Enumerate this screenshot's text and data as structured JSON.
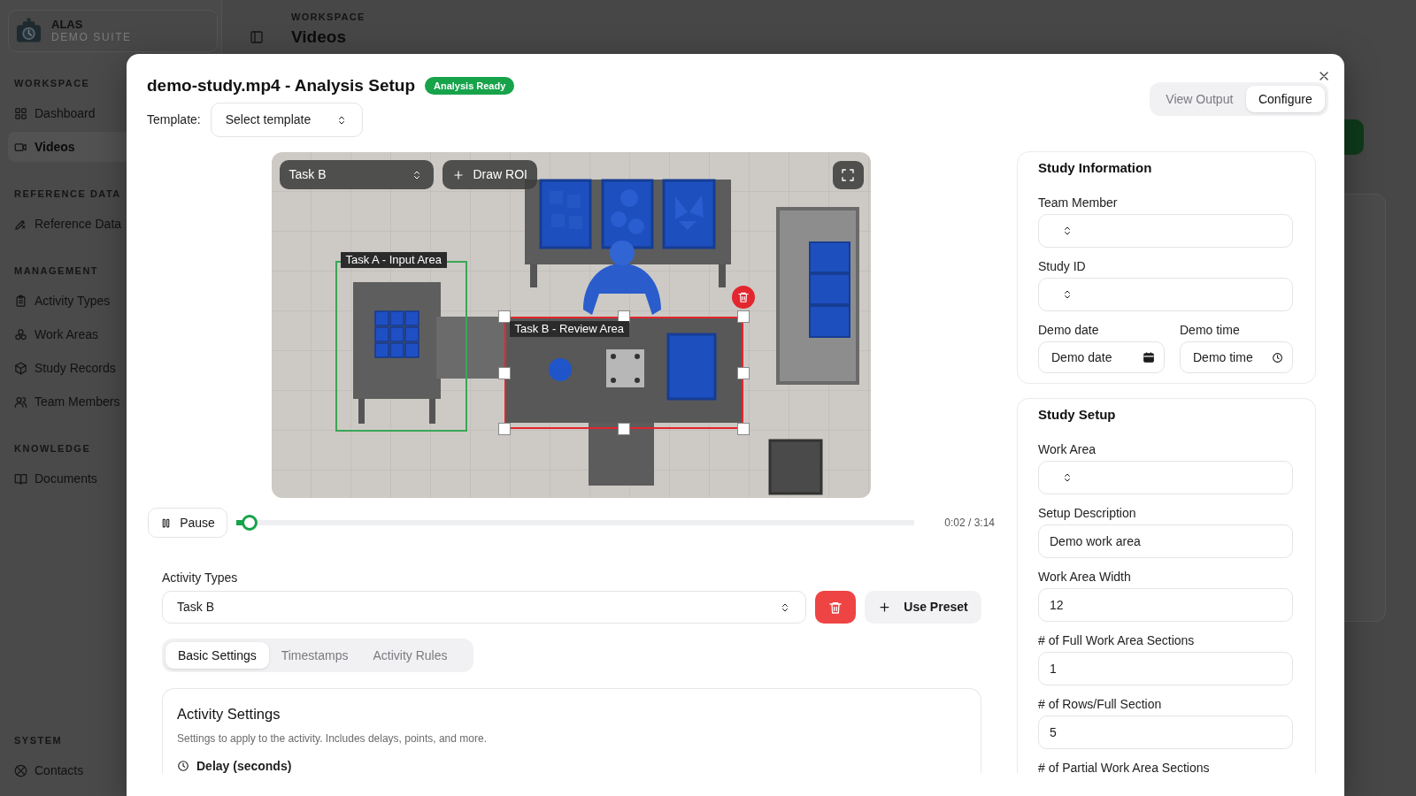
{
  "sidebar": {
    "brand": {
      "name": "ALAS",
      "tagline": "DEMO SUITE"
    },
    "sections": [
      {
        "heading": "WORKSPACE",
        "items": [
          {
            "label": "Dashboard",
            "selected": false
          },
          {
            "label": "Videos",
            "selected": true
          }
        ]
      },
      {
        "heading": "REFERENCE DATA",
        "items": [
          {
            "label": "Reference Data",
            "selected": false
          }
        ]
      },
      {
        "heading": "MANAGEMENT",
        "items": [
          {
            "label": "Activity Types",
            "selected": false
          },
          {
            "label": "Work Areas",
            "selected": false
          },
          {
            "label": "Study Records",
            "selected": false
          },
          {
            "label": "Team Members",
            "selected": false
          }
        ]
      },
      {
        "heading": "KNOWLEDGE",
        "items": [
          {
            "label": "Documents",
            "selected": false
          }
        ]
      },
      {
        "heading": "SYSTEM",
        "items": [
          {
            "label": "Contacts",
            "selected": false
          }
        ]
      }
    ]
  },
  "header": {
    "section": "WORKSPACE",
    "title": "Videos"
  },
  "modal": {
    "title": "demo-study.mp4 - Analysis Setup",
    "status_badge": "Analysis Ready",
    "template": {
      "label": "Template:",
      "value": "Select template"
    },
    "view_tabs": [
      {
        "label": "View Output",
        "selected": false
      },
      {
        "label": "Configure",
        "selected": true
      }
    ],
    "video": {
      "task_select": "Task B",
      "draw_button": "Draw ROI",
      "regions": [
        {
          "label": "Task A - Input Area",
          "color": "#3aa656",
          "selected": false
        },
        {
          "label": "Task B - Review Area",
          "color": "#e3262f",
          "selected": true
        }
      ]
    },
    "player": {
      "button": "Pause",
      "level": 0.02,
      "time": "0:02 / 3:14"
    },
    "activity_types": {
      "label": "Activity Types",
      "value": "Task B",
      "preset_button": "Use Preset"
    },
    "settings_tabs": [
      {
        "label": "Basic Settings",
        "selected": true
      },
      {
        "label": "Timestamps",
        "selected": false
      },
      {
        "label": "Activity Rules",
        "selected": false
      }
    ],
    "activity_settings": {
      "title": "Activity Settings",
      "description": "Settings to apply to the activity. Includes delays, points, and more.",
      "fields": [
        {
          "label": "Delay (seconds)"
        }
      ]
    },
    "panels": [
      {
        "title": "Study Information",
        "fields": [
          {
            "kind": "select",
            "label": "Team Member"
          },
          {
            "kind": "select",
            "label": "Study ID"
          },
          {
            "kind": "date",
            "label": "Demo date",
            "value": "Demo date"
          },
          {
            "kind": "time",
            "label": "Demo time",
            "value": "Demo time"
          }
        ]
      },
      {
        "title": "Study Setup",
        "fields": [
          {
            "kind": "select",
            "label": "Work Area"
          },
          {
            "kind": "text",
            "label": "Setup Description",
            "value": "Demo work area"
          },
          {
            "kind": "text",
            "label": "Work Area Width",
            "value": "12"
          },
          {
            "kind": "text",
            "label": "# of Full Work Area Sections",
            "value": "1"
          },
          {
            "kind": "text",
            "label": "# of Rows/Full Section",
            "value": "5"
          },
          {
            "kind": "label",
            "label": "# of Partial Work Area Sections"
          }
        ]
      }
    ]
  }
}
